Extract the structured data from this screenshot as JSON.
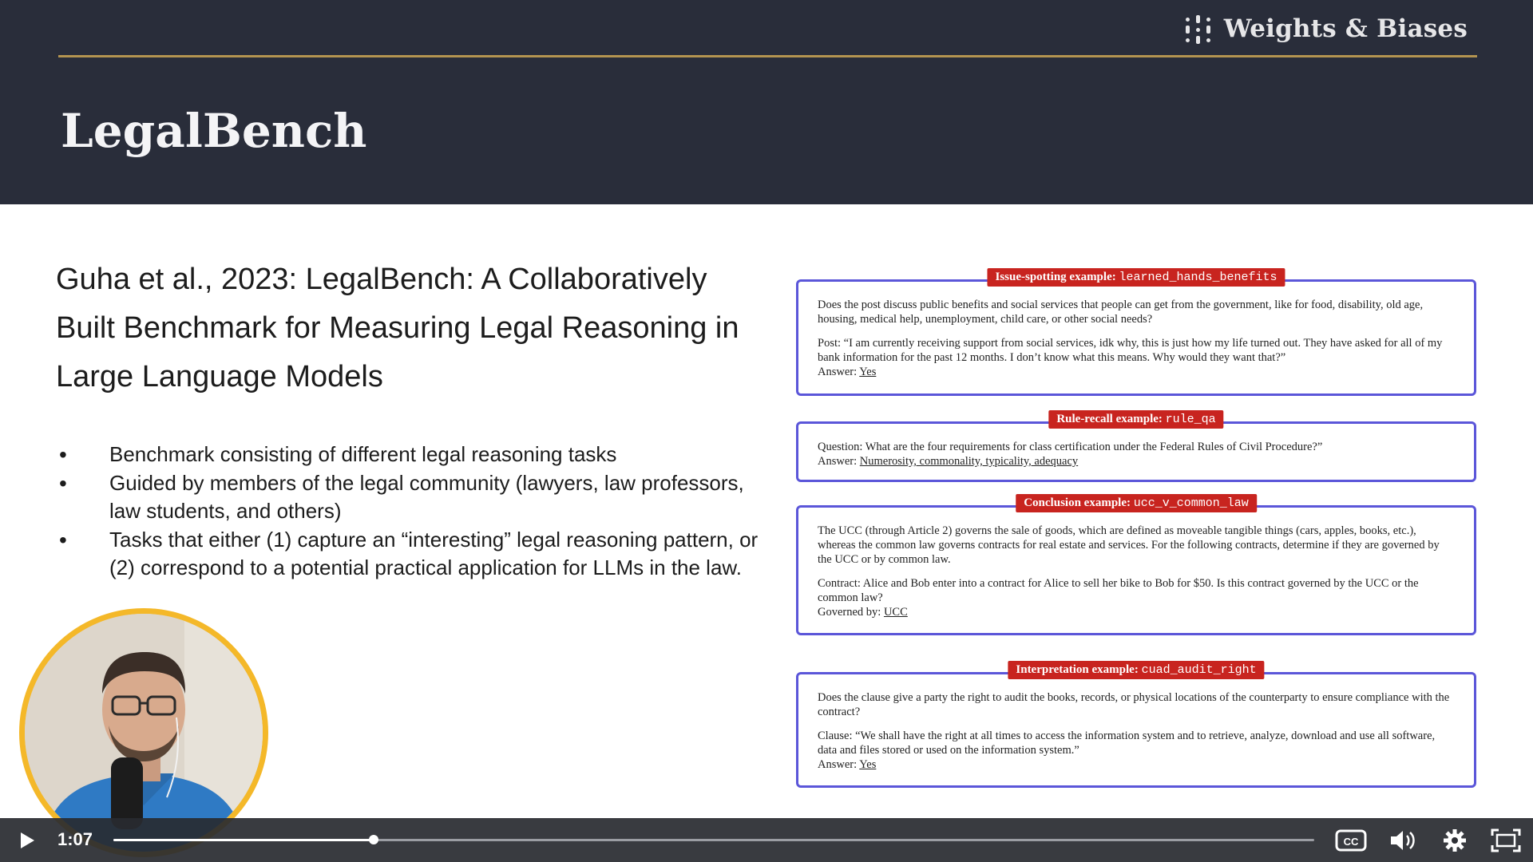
{
  "brand": {
    "name": "Weights & Biases",
    "icon": "wandb-dots-icon"
  },
  "slide": {
    "title": "LegalBench",
    "citation": "Guha et al., 2023: LegalBench: A Collaboratively Built Benchmark for Measuring Legal Reasoning in Large Language Models",
    "bullets": [
      "Benchmark consisting of different legal reasoning tasks",
      "Guided by members of the legal community (lawyers, law professors, law students, and others)",
      "Tasks that either (1) capture an “interesting” legal reasoning pattern, or (2) correspond to a potential practical application for LLMs in the law."
    ]
  },
  "examples": {
    "issue": {
      "label": "Issue-spotting example:",
      "code": "learned_hands_benefits",
      "question": "Does the post discuss public benefits and social services that people can get from the government, like for food, disability, old age, housing, medical help, unemployment, child care, or other social needs?",
      "post": "Post: “I am currently receiving support from social services, idk why, this is just how my life turned out. They have asked for all of my bank information for the past 12 months. I don’t know what this means. Why would they want that?”",
      "answer_label": "Answer:",
      "answer": "Yes"
    },
    "rule": {
      "label": "Rule-recall example:",
      "code": "rule_qa",
      "question": "Question: What are the four requirements for class certification under the Federal Rules of Civil Procedure?”",
      "answer_label": "Answer:",
      "answer": "Numerosity, commonality, typicality, adequacy"
    },
    "conclusion": {
      "label": "Conclusion example:",
      "code": "ucc_v_common_law",
      "question": "The UCC (through Article 2) governs the sale of goods, which are defined as moveable tangible things (cars, apples, books, etc.), whereas the common law governs contracts for real estate and services. For the following contracts, determine if they are governed by the UCC or by common law.",
      "contract": "Contract: Alice and Bob enter into a contract for Alice to sell her bike to Bob for $50. Is this contract governed by the UCC or the common law?",
      "answer_label": "Governed by:",
      "answer": "UCC"
    },
    "interpretation": {
      "label": "Interpretation example:",
      "code": "cuad_audit_right",
      "question": "Does the clause give a party the right to audit the books, records, or physical locations of the counterparty to ensure compliance with the contract?",
      "clause": "Clause: “We shall have the right at all times to access the information system and to retrieve, analyze, download and use all software, data and files stored or used on the information system.”",
      "answer_label": "Answer:",
      "answer": "Yes"
    }
  },
  "player": {
    "time": "1:07",
    "progress": 0.217,
    "icons": {
      "play": "play-icon",
      "cc": "closed-captions-icon",
      "volume": "volume-icon",
      "settings": "settings-gear-icon",
      "fullscreen": "fullscreen-icon"
    }
  },
  "colors": {
    "header_bg": "#292d3a",
    "gold_rule": "#b39450",
    "label_red": "#c8241f",
    "box_border": "#5b56d9",
    "presenter_ring": "#f4b829"
  }
}
